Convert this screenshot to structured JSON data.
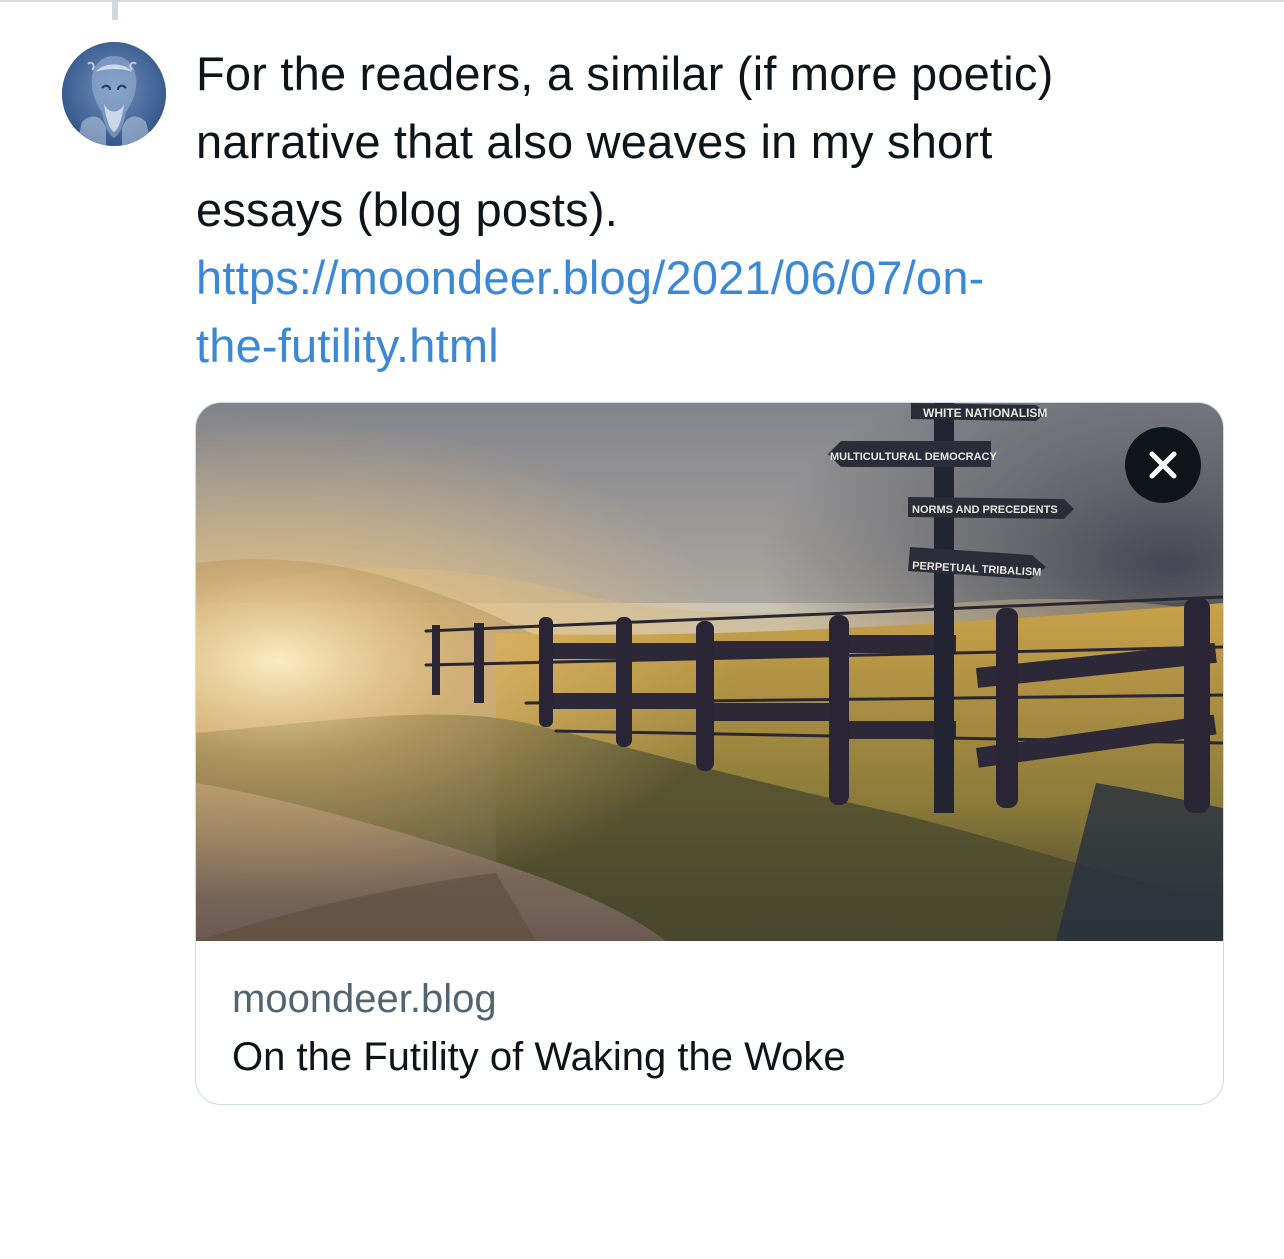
{
  "tweet": {
    "text_lines": [
      "For the readers, a similar (if more poetic)",
      "narrative that also weaves in my short",
      "essays (blog posts)."
    ],
    "link_lines": [
      "https://moondeer.blog/2021/06/07/on-",
      "the-futility.html"
    ]
  },
  "link_card": {
    "domain": "moondeer.blog",
    "title": "On the Futility of Waking the Woke",
    "image": {
      "signposts": [
        "WHITE NATIONALISM",
        "MULTICULTURAL DEMOCRACY",
        "NORMS AND PRECEDENTS",
        "PERPETUAL TRIBALISM"
      ]
    },
    "close_icon": "close-icon"
  },
  "colors": {
    "link": "#3b89d6",
    "text": "#0f1419",
    "secondary_text": "#536471",
    "card_border": "#cfd9de"
  }
}
